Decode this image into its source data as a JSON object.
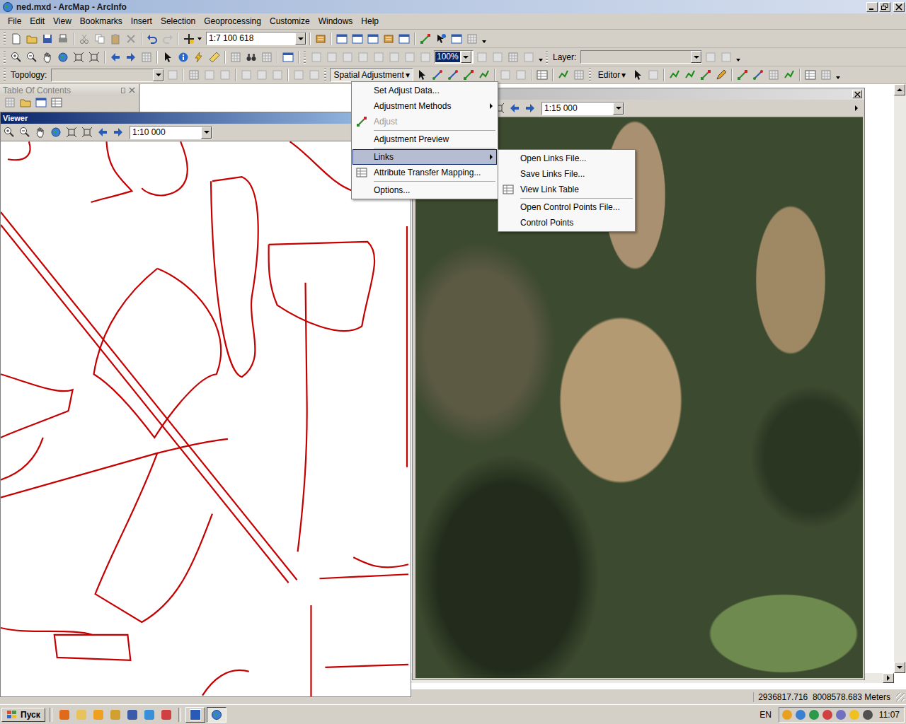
{
  "window": {
    "title": "ned.mxd - ArcMap - ArcInfo"
  },
  "menu_bar": [
    "File",
    "Edit",
    "View",
    "Bookmarks",
    "Insert",
    "Selection",
    "Geoprocessing",
    "Customize",
    "Windows",
    "Help"
  ],
  "standard_toolbar": {
    "scale": "1:7 100 618"
  },
  "tools_toolbar": {
    "zoom": "100%",
    "layer_label": "Layer:",
    "layer_value": ""
  },
  "topology_toolbar": {
    "label": "Topology:",
    "value": ""
  },
  "spatial_adjustment_toolbar": {
    "label": "Spatial Adjustment",
    "arrow": "▾",
    "open": true
  },
  "editor_toolbar": {
    "label": "Editor",
    "arrow": "▾"
  },
  "table_of_contents": {
    "title": "Table Of Contents"
  },
  "viewers": [
    {
      "title": "Viewer",
      "scale": "1:10 000",
      "kind": "vector",
      "active": true
    },
    {
      "title": "",
      "scale": "1:15 000",
      "kind": "imagery",
      "active": false
    }
  ],
  "spatial_adjustment_menu": {
    "items": [
      {
        "label": "Set Adjust Data...",
        "disabled": false,
        "submenu": false,
        "selected": false,
        "has_icon": false,
        "separator_after": false
      },
      {
        "label": "Adjustment Methods",
        "disabled": false,
        "submenu": true,
        "selected": false,
        "has_icon": false,
        "separator_after": false
      },
      {
        "label": "Adjust",
        "disabled": true,
        "submenu": false,
        "selected": false,
        "has_icon": true,
        "separator_after": true
      },
      {
        "label": "Adjustment Preview",
        "disabled": false,
        "submenu": false,
        "selected": false,
        "has_icon": false,
        "separator_after": true
      },
      {
        "label": "Links",
        "disabled": false,
        "submenu": true,
        "selected": true,
        "has_icon": false,
        "separator_after": false
      },
      {
        "label": "Attribute Transfer Mapping...",
        "disabled": false,
        "submenu": false,
        "selected": false,
        "has_icon": true,
        "separator_after": true
      },
      {
        "label": "Options...",
        "disabled": false,
        "submenu": false,
        "selected": false,
        "has_icon": false,
        "separator_after": false
      }
    ]
  },
  "links_submenu": {
    "items": [
      {
        "label": "Open Links File...",
        "disabled": false,
        "selected": false,
        "has_icon": false,
        "separator_after": false
      },
      {
        "label": "Save Links File...",
        "disabled": false,
        "selected": false,
        "has_icon": false,
        "separator_after": false
      },
      {
        "label": "View Link Table",
        "disabled": false,
        "selected": false,
        "has_icon": true,
        "separator_after": true
      },
      {
        "label": "Open Control Points File...",
        "disabled": false,
        "selected": false,
        "has_icon": false,
        "separator_after": false
      },
      {
        "label": "Control Points",
        "disabled": false,
        "selected": false,
        "has_icon": false,
        "separator_after": false
      }
    ]
  },
  "status_bar": {
    "coordinates": "2936817.716  8008578.683 Meters"
  },
  "taskbar": {
    "start": "Пуск",
    "language": "EN",
    "clock": "11:07"
  }
}
